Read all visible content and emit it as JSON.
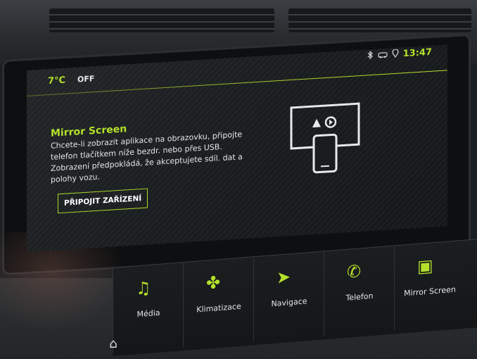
{
  "status_bar": {
    "temperature": "7°C",
    "climate_state": "OFF",
    "time": "13:47",
    "icons": [
      "bluetooth-icon",
      "connected-car-icon",
      "location-icon"
    ]
  },
  "mirror_screen": {
    "title": "Mirror Screen",
    "description": "Chcete-li zobrazit aplikace na obrazovku, připojte telefon tlačítkem níže bezdr. nebo přes USB. Zobrazení předpokládá, že akceptujete sdíl. dat a polohy vozu.",
    "connect_button": "PŘIPOJIT ZAŘÍZENÍ"
  },
  "nav_bar": {
    "items": [
      {
        "label": "Média",
        "icon": "music-note-icon"
      },
      {
        "label": "Klimatizace",
        "icon": "fan-thermometer-icon"
      },
      {
        "label": "Navigace",
        "icon": "navigation-arrow-icon"
      },
      {
        "label": "Telefon",
        "icon": "phone-icon"
      },
      {
        "label": "Mirror Screen",
        "icon": "mirror-screen-icon"
      }
    ]
  },
  "colors": {
    "accent": "#b4e12b",
    "screen_bg": "#1a1d1f",
    "text": "#e6e6e6"
  }
}
